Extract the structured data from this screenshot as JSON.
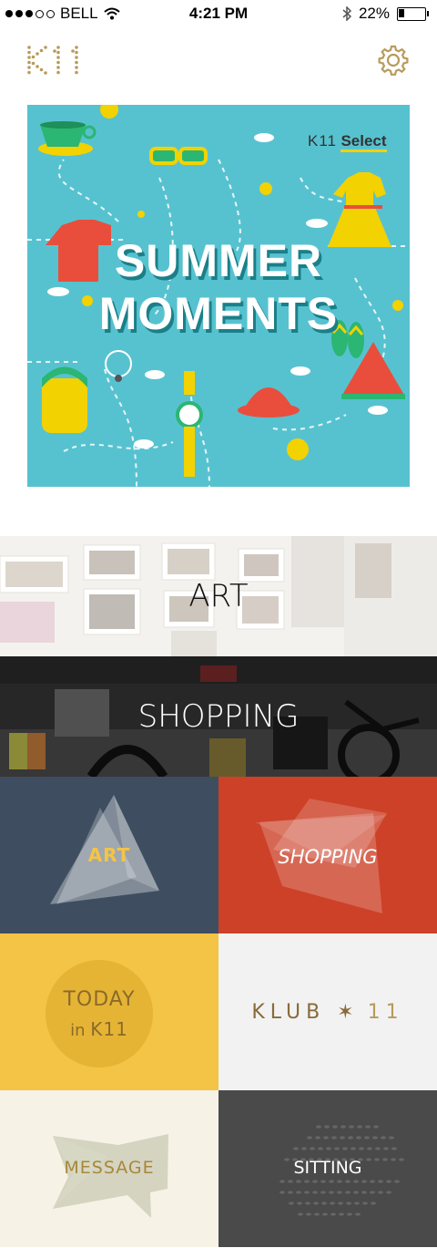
{
  "status_bar": {
    "carrier": "BELL",
    "time": "4:21 PM",
    "battery": "22%",
    "battery_level": 0.22
  },
  "header": {
    "logo_text": "K11",
    "settings_icon": "gear-icon"
  },
  "banner": {
    "brand_prefix": "K11",
    "brand_name": "Select",
    "title_line1": "SUMMER",
    "title_line2": "MOMENTS"
  },
  "sections": {
    "art": "ART",
    "shopping": "SHOPPING"
  },
  "tiles": {
    "art": "ART",
    "shopping": "SHOPPING",
    "today_line1": "TODAY",
    "today_in": "in",
    "today_brand": "K11",
    "klub": "KLUB",
    "klub_star": "✶",
    "klub_number": "11",
    "message": "MESSAGE",
    "sitting": "SITTING"
  },
  "colors": {
    "art_tile": "#3e4e60",
    "shopping_tile": "#cc4128",
    "today_tile": "#f4c446",
    "klub_tile": "#f2f2f2",
    "message_tile": "#f6f2e6",
    "sitting_tile": "#4a4a4a",
    "gold": "#b79b5a",
    "banner_bg": "#57c2cf"
  }
}
